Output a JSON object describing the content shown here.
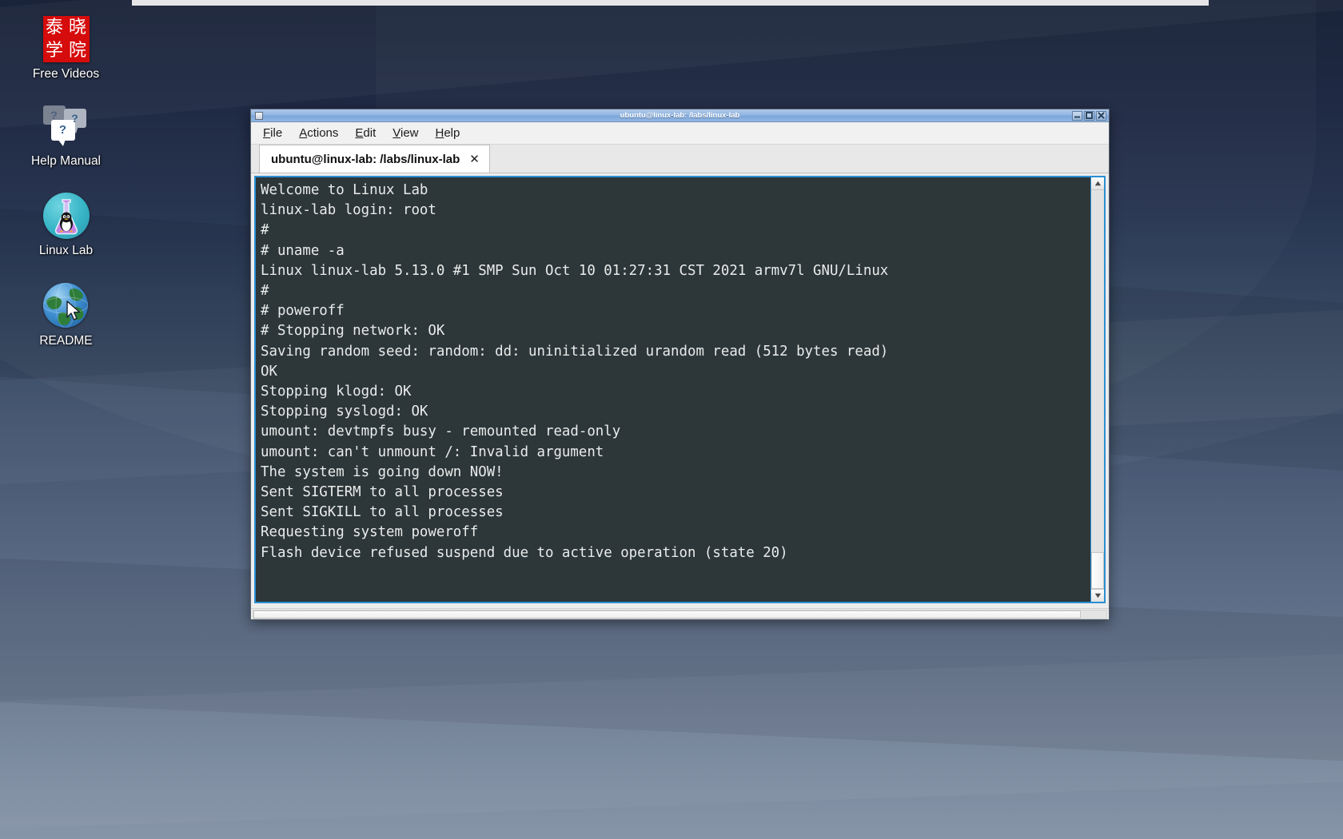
{
  "desktop": {
    "icons": [
      {
        "label": "Free Videos",
        "icon": "seal-logo-icon",
        "seal_chars": [
          "泰",
          "晓",
          "学",
          "院"
        ]
      },
      {
        "label": "Help Manual",
        "icon": "speech-bubbles-question-icon",
        "bubble_marks": [
          "?",
          "?",
          "?"
        ]
      },
      {
        "label": "Linux Lab",
        "icon": "flask-penguin-icon"
      },
      {
        "label": "README",
        "icon": "globe-cursor-icon"
      }
    ]
  },
  "window": {
    "title": "ubuntu@linux-lab: /labs/linux-lab",
    "controls": {
      "minimize": "minimize-button",
      "maximize": "maximize-button",
      "close": "close-button"
    },
    "menu": [
      {
        "label": "File",
        "mnemonic": "F"
      },
      {
        "label": "Actions",
        "mnemonic": "A"
      },
      {
        "label": "Edit",
        "mnemonic": "E"
      },
      {
        "label": "View",
        "mnemonic": "V"
      },
      {
        "label": "Help",
        "mnemonic": "H"
      }
    ],
    "tabs": [
      {
        "label": "ubuntu@linux-lab: /labs/linux-lab",
        "close": "✕",
        "active": true
      }
    ]
  },
  "terminal": {
    "lines": [
      "Welcome to Linux Lab",
      "linux-lab login: root",
      "#",
      "# uname -a",
      "Linux linux-lab 5.13.0 #1 SMP Sun Oct 10 01:27:31 CST 2021 armv7l GNU/Linux",
      "#",
      "# poweroff",
      "# Stopping network: OK",
      "Saving random seed: random: dd: uninitialized urandom read (512 bytes read)",
      "OK",
      "Stopping klogd: OK",
      "Stopping syslogd: OK",
      "umount: devtmpfs busy - remounted read-only",
      "umount: can't unmount /: Invalid argument",
      "The system is going down NOW!",
      "Sent SIGTERM to all processes",
      "Sent SIGKILL to all processes",
      "Requesting system poweroff",
      "Flash device refused suspend due to active operation (state 20)"
    ],
    "colors": {
      "background": "#2d3638",
      "foreground": "#e9ecec",
      "border": "#2a8fd4"
    }
  },
  "scrollbar": {
    "up_arrow": "scroll-up-icon",
    "down_arrow": "scroll-down-icon"
  }
}
